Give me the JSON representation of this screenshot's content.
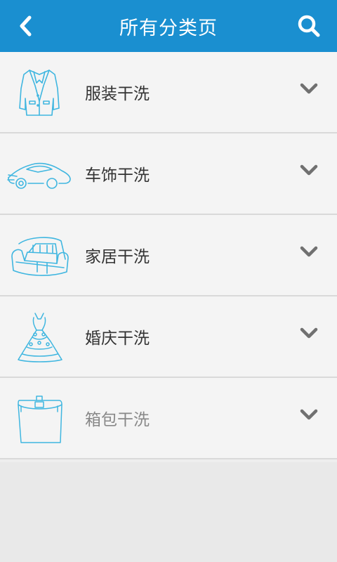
{
  "header": {
    "title": "所有分类页",
    "back_icon": "chevron-left-icon",
    "search_icon": "search-icon",
    "bg_color": "#1a8fd0"
  },
  "categories": [
    {
      "label": "服装干洗",
      "icon": "jacket-icon",
      "disabled": false
    },
    {
      "label": "车饰干洗",
      "icon": "car-icon",
      "disabled": false
    },
    {
      "label": "家居干洗",
      "icon": "sofa-icon",
      "disabled": false
    },
    {
      "label": "婚庆干洗",
      "icon": "wedding-dress-icon",
      "disabled": false
    },
    {
      "label": "箱包干洗",
      "icon": "bag-icon",
      "disabled": true
    }
  ],
  "accent_line_color": "#3fb6e0"
}
